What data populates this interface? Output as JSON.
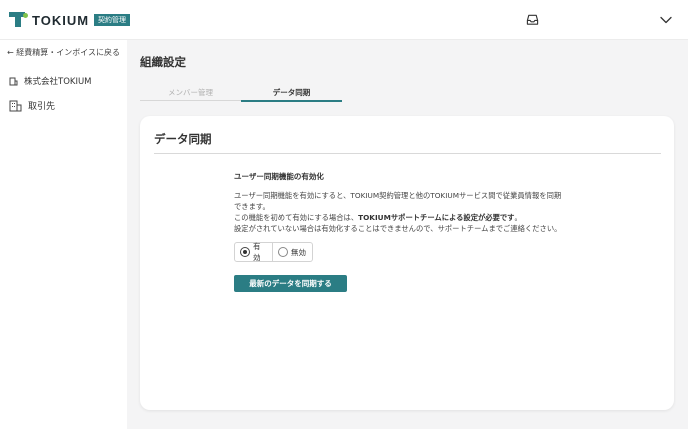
{
  "header": {
    "logo_text": "TOKIUM",
    "logo_badge": "契約管理"
  },
  "sidebar": {
    "back_link": "← 経費精算・インボイスに戻る",
    "items": [
      {
        "label": "株式会社TOKIUM",
        "icon": "building-icon"
      },
      {
        "label": "取引先",
        "icon": "office-building-icon"
      }
    ]
  },
  "main": {
    "page_title": "組織設定",
    "tabs": [
      {
        "label": "メンバー管理",
        "active": false
      },
      {
        "label": "データ同期",
        "active": true
      }
    ],
    "card": {
      "title": "データ同期",
      "section_title": "ユーザー同期機能の有効化",
      "desc_line1": "ユーザー同期機能を有効にすると、TOKIUM契約管理と他のTOKIUMサービス間で従業員情報を同期",
      "desc_line2": "できます。",
      "desc_line3_prefix": "この機能を初めて有効にする場合は、",
      "desc_line3_bold": "TOKIUMサポートチームによる設定が必要です",
      "desc_line3_suffix": "。",
      "desc_line4": "設定がされていない場合は有効化することはできませんので、サポートチームまでご連絡ください。",
      "radio_enabled": "有効",
      "radio_disabled": "無効",
      "selected": "有効",
      "sync_button": "最新のデータを同期する"
    }
  },
  "colors": {
    "accent": "#2b7d84",
    "logo_dot": "#7fc24a",
    "background": "#f4f4f5"
  }
}
